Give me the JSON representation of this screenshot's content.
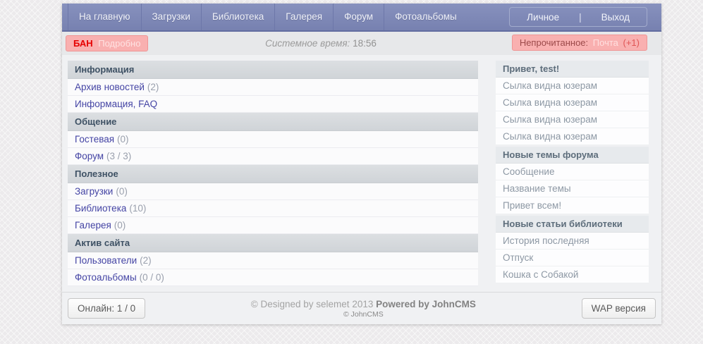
{
  "nav": {
    "items": [
      {
        "label": "На главную"
      },
      {
        "label": "Загрузки"
      },
      {
        "label": "Библиотека"
      },
      {
        "label": "Галерея"
      },
      {
        "label": "Форум"
      },
      {
        "label": "Фотоальбомы"
      }
    ],
    "personal_label": "Личное",
    "separator": "|",
    "logout_label": "Выход"
  },
  "statusbar": {
    "ban_label": "БАН",
    "ban_link": "Подробно",
    "system_time_label": "Системное время:",
    "system_time_value": "18:56",
    "unread_label": "Непрочитанное:",
    "unread_link": "Почта",
    "unread_count": "(+1)"
  },
  "menu": {
    "sections": [
      {
        "title": "Информация",
        "items": [
          {
            "label": "Архив новостей",
            "count": "(2)"
          },
          {
            "label": "Информация, FAQ",
            "count": ""
          }
        ]
      },
      {
        "title": "Общение",
        "items": [
          {
            "label": "Гостевая",
            "count": "(0)"
          },
          {
            "label": "Форум",
            "count": "(3 / 3)"
          }
        ]
      },
      {
        "title": "Полезное",
        "items": [
          {
            "label": "Загрузки",
            "count": "(0)"
          },
          {
            "label": "Библиотека",
            "count": "(10)"
          },
          {
            "label": "Галерея",
            "count": "(0)"
          }
        ]
      },
      {
        "title": "Актив сайта",
        "items": [
          {
            "label": "Пользователи",
            "count": "(2)"
          },
          {
            "label": "Фотоальбомы",
            "count": "(0 / 0)"
          }
        ]
      }
    ]
  },
  "sidebar": {
    "sections": [
      {
        "title": "Привет, test!",
        "items": [
          "Сылка видна юзерам",
          "Сылка видна юзерам",
          "Сылка видна юзерам",
          "Сылка видна юзерам"
        ]
      },
      {
        "title": "Новые темы форума",
        "items": [
          "Сообщение",
          "Название темы",
          "Привет всем!"
        ]
      },
      {
        "title": "Новые статьи библиотеки",
        "items": [
          "История последняя",
          "Отпуск",
          "Кошка с Собакой"
        ]
      }
    ]
  },
  "footer": {
    "online_label": "Онлайн: 1 / 0",
    "copyright_regular": "© Designed by selemet 2013",
    "copyright_bold": "Powered by JohnCMS",
    "copyright_small": "© JohnCMS",
    "wap_label": "WAP версия"
  },
  "colors": {
    "nav_bg": "#7c86b5",
    "nav_border": "#636da1",
    "badge_bg": "#f9b0b0",
    "badge_border": "#ef9595",
    "ban_text": "#e60000",
    "menu_link": "#4444a4",
    "section_header_text": "#3e5164",
    "sidebar_text": "#8d98a4",
    "page_bg": "#f0f1f3"
  }
}
